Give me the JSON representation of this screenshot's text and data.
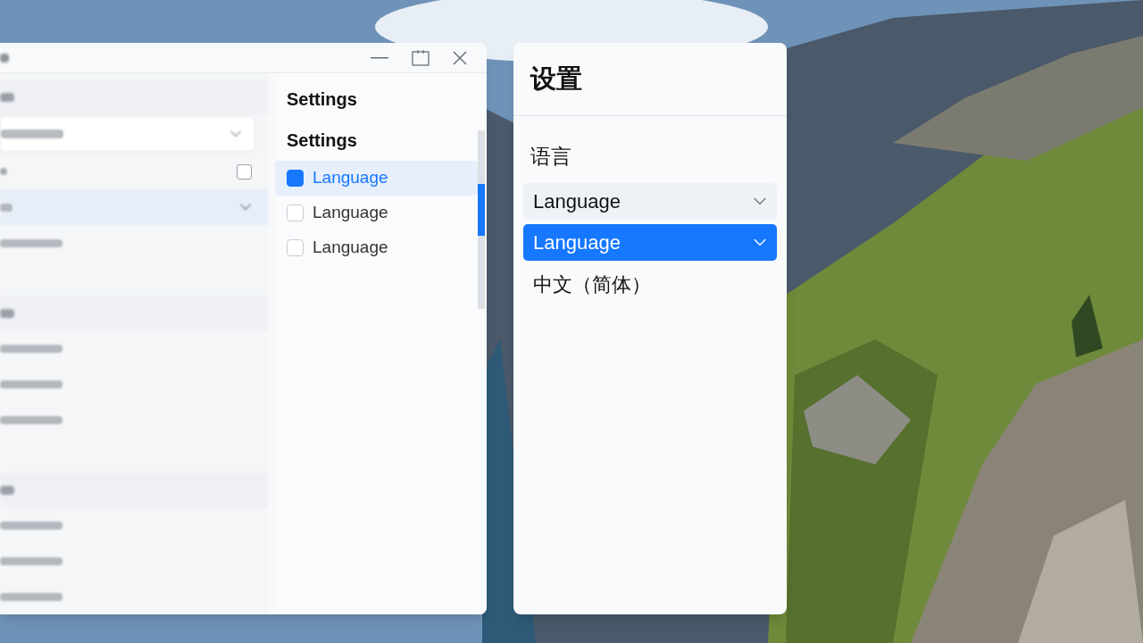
{
  "left_window": {
    "blurred_list": [
      {
        "kind": "header"
      },
      {
        "kind": "dropdown"
      },
      {
        "kind": "checkbox",
        "checked": false
      },
      {
        "kind": "item",
        "selected": true
      },
      {
        "kind": "item",
        "selected": false
      },
      {
        "kind": "blank"
      },
      {
        "kind": "header"
      },
      {
        "kind": "item",
        "selected": false
      },
      {
        "kind": "item",
        "selected": false
      },
      {
        "kind": "item",
        "selected": false
      },
      {
        "kind": "blank"
      },
      {
        "kind": "header"
      },
      {
        "kind": "item",
        "selected": false
      },
      {
        "kind": "item",
        "selected": false
      },
      {
        "kind": "item",
        "selected": false
      }
    ],
    "pane": {
      "title": "Settings",
      "section": "Settings",
      "items": [
        {
          "label": "Language",
          "selected": true
        },
        {
          "label": "Language",
          "selected": false
        },
        {
          "label": "Language",
          "selected": false
        }
      ],
      "scrollbar": {
        "level": 0.3
      }
    }
  },
  "settings_panel": {
    "title": "设置",
    "section": "语言",
    "options": [
      {
        "label": "Language",
        "selected": false,
        "kind": "dropdown"
      },
      {
        "label": "Language",
        "selected": true,
        "kind": "dropdown"
      },
      {
        "label": "中文（简体）",
        "selected": false,
        "kind": "option"
      }
    ]
  }
}
